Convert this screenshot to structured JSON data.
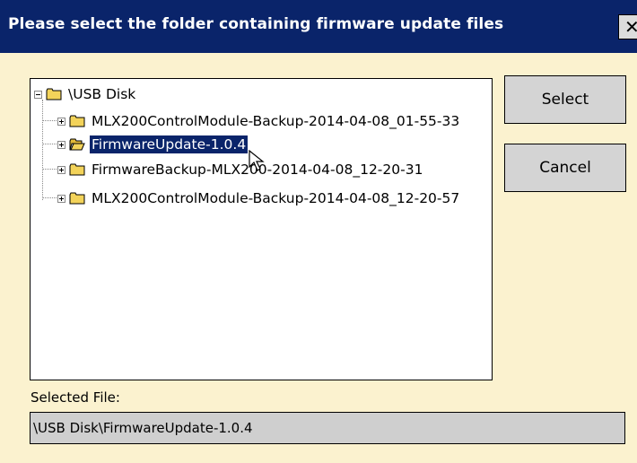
{
  "window": {
    "title": "Please select the folder containing firmware update files",
    "close_label": "✕"
  },
  "tree": {
    "root": {
      "label": "\\USB Disk",
      "icon": "folder-icon",
      "expanded": true
    },
    "items": [
      {
        "label": "MLX200ControlModule-Backup-2014-04-08_01-55-33",
        "icon": "folder-icon",
        "selected": false
      },
      {
        "label": "FirmwareUpdate-1.0.4",
        "icon": "folder-open-icon",
        "selected": true
      },
      {
        "label": "FirmwareBackup-MLX200-2014-04-08_12-20-31",
        "icon": "folder-icon",
        "selected": false
      },
      {
        "label": "MLX200ControlModule-Backup-2014-04-08_12-20-57",
        "icon": "folder-icon",
        "selected": false
      }
    ]
  },
  "buttons": {
    "select_label": "Select",
    "cancel_label": "Cancel"
  },
  "selected_file": {
    "label": "Selected File:",
    "value": "\\USB Disk\\FirmwareUpdate-1.0.4"
  },
  "colors": {
    "titlebar": "#0a246a",
    "background": "#fbf2cf",
    "selection": "#0a246a",
    "folder": "#f3d35a"
  }
}
